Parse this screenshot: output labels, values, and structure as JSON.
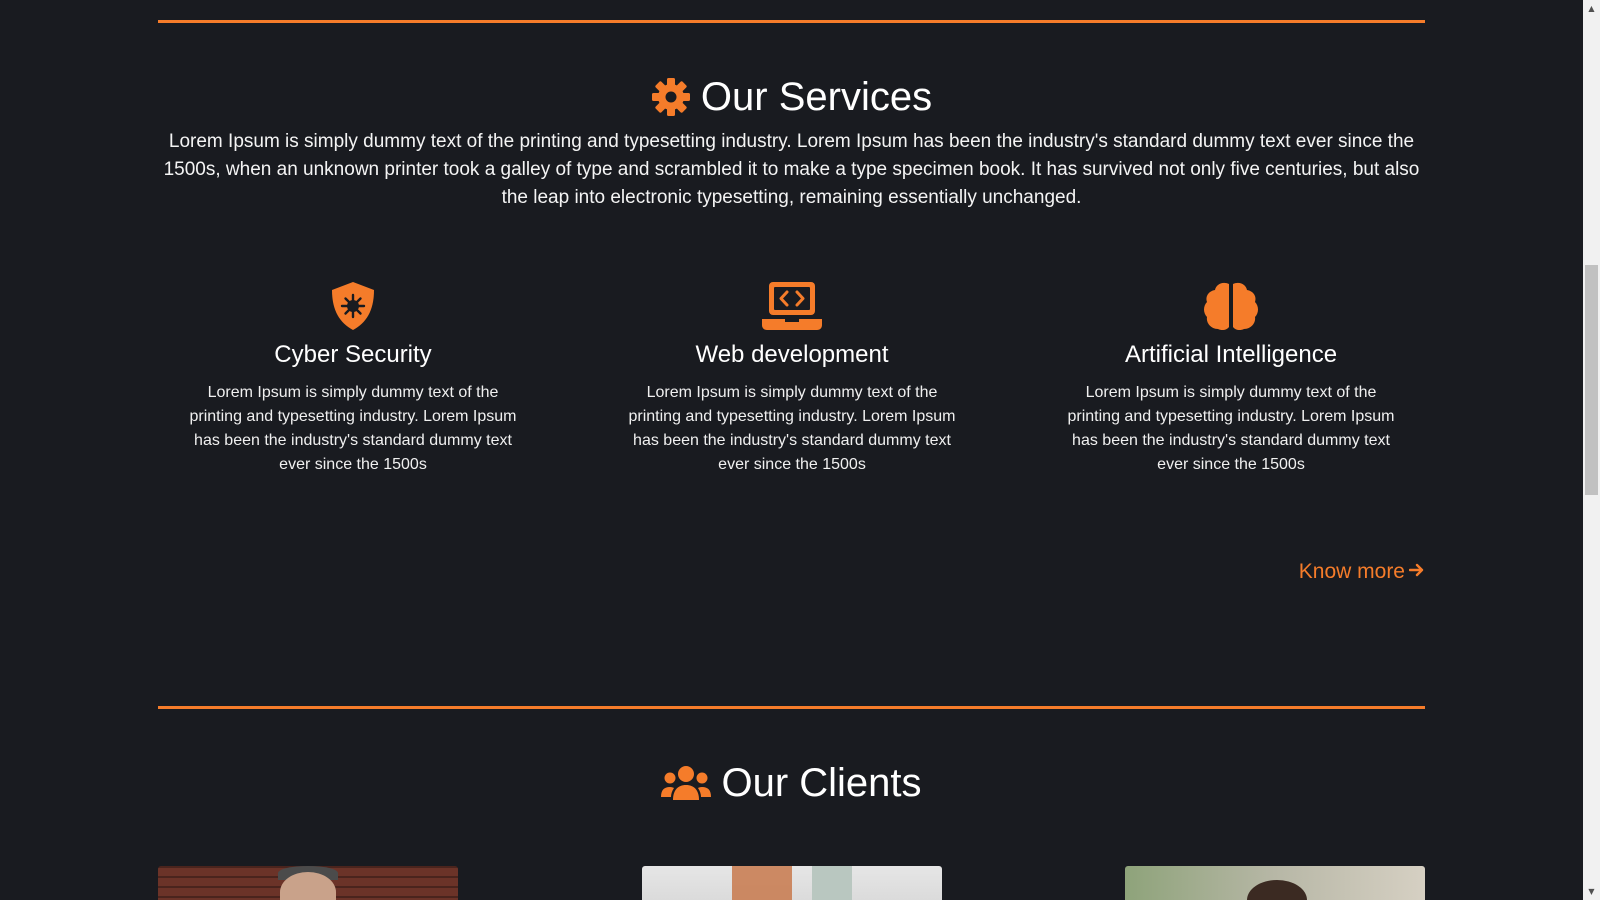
{
  "colors": {
    "background": "#191b20",
    "accent": "#f57c2a",
    "text": "#ffffff"
  },
  "services": {
    "icon": "gear-icon",
    "title": "Our Services",
    "intro": "Lorem Ipsum is simply dummy text of the printing and typesetting industry. Lorem Ipsum has been the industry's standard dummy text ever since the 1500s, when an unknown printer took a galley of type and scrambled it to make a type specimen book. It has survived not only five centuries, but also the leap into electronic typesetting, remaining essentially unchanged.",
    "items": [
      {
        "icon": "shield-virus-icon",
        "title": "Cyber Security",
        "text": "Lorem Ipsum is simply dummy text of the printing and typesetting industry. Lorem Ipsum has been the industry's standard dummy text ever since the 1500s"
      },
      {
        "icon": "laptop-code-icon",
        "title": "Web development",
        "text": "Lorem Ipsum is simply dummy text of the printing and typesetting industry. Lorem Ipsum has been the industry's standard dummy text ever since the 1500s"
      },
      {
        "icon": "brain-icon",
        "title": "Artificial Intelligence",
        "text": "Lorem Ipsum is simply dummy text of the printing and typesetting industry. Lorem Ipsum has been the industry's standard dummy text ever since the 1500s"
      }
    ],
    "know_more": "Know more",
    "know_more_icon": "arrow-right-icon"
  },
  "clients": {
    "icon": "users-icon",
    "title": "Our Clients",
    "photos": [
      "client-photo",
      "client-photo",
      "client-photo"
    ]
  }
}
